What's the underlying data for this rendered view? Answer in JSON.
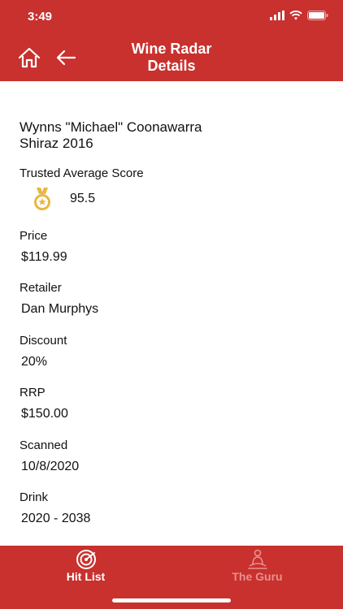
{
  "colors": {
    "accent": "#c8312e",
    "tab_active": "#ffffff",
    "tab_inactive": "#e8918e",
    "medal": "#e7b743"
  },
  "status_bar": {
    "time": "3:49",
    "icons": [
      "signal-icon",
      "wifi-icon",
      "battery-icon"
    ]
  },
  "header": {
    "title_line1": "Wine Radar",
    "title_line2": "Details",
    "home_icon": "home-icon",
    "back_icon": "back-arrow-icon"
  },
  "wine": {
    "name_line1": "Wynns \"Michael\" Coonawarra",
    "name_line2": "Shiraz 2016",
    "score_label": "Trusted Average Score",
    "score_icon": "medal-icon",
    "score_value": "95.5",
    "price_label": "Price",
    "price_value": "$119.99",
    "retailer_label": "Retailer",
    "retailer_value": "Dan Murphys",
    "discount_label": "Discount",
    "discount_value": "20%",
    "rrp_label": "RRP",
    "rrp_value": "$150.00",
    "scanned_label": "Scanned",
    "scanned_value": "10/8/2020",
    "drink_label": "Drink",
    "drink_value": "2020 - 2038"
  },
  "tabs": [
    {
      "label": "Hit List",
      "icon": "radar-icon",
      "active": true
    },
    {
      "label": "The Guru",
      "icon": "guru-icon",
      "active": false
    }
  ]
}
